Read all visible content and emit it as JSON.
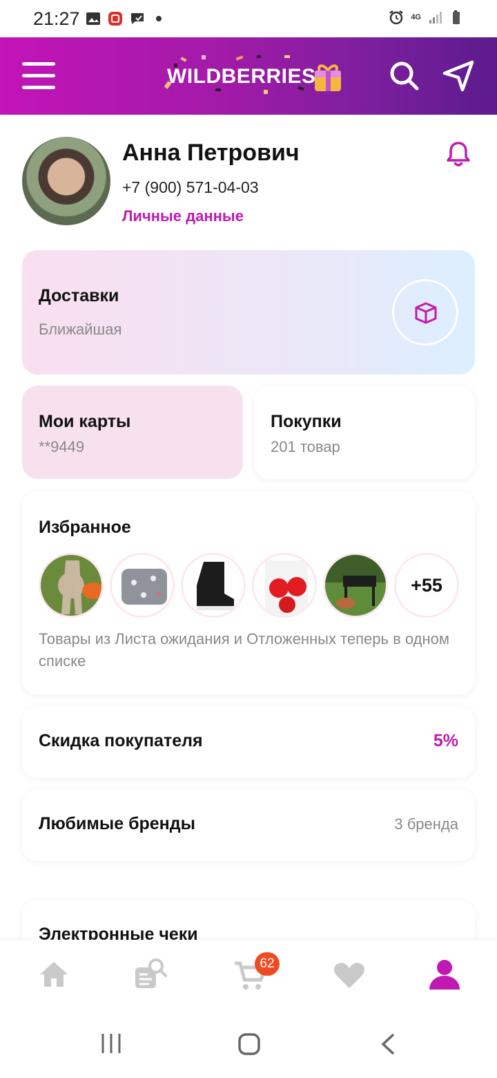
{
  "status_bar": {
    "time": "21:27",
    "network": "4G",
    "icons": [
      "image-icon",
      "app-icon",
      "message-icon",
      "alarm-icon",
      "signal-icon",
      "battery-icon"
    ]
  },
  "header": {
    "brand": "WILDBERRIES",
    "icons": [
      "menu-icon",
      "search-icon",
      "send-icon"
    ],
    "gradient": [
      "#c214b8",
      "#5c1b8c"
    ]
  },
  "profile": {
    "name": "Анна Петрович",
    "phone": "+7 (900) 571-04-03",
    "personal_data_link": "Личные данные"
  },
  "deliveries": {
    "title": "Доставки",
    "subtitle": "Ближайшая"
  },
  "my_cards": {
    "title": "Мои карты",
    "subtitle": "**9449"
  },
  "purchases": {
    "title": "Покупки",
    "subtitle": "201 товар"
  },
  "favorites": {
    "title": "Избранное",
    "items": [
      "pants",
      "pillowcase",
      "boot",
      "tomato-seeds",
      "grill"
    ],
    "more": "+55",
    "note": "Товары из Листа ожидания и Отложенных теперь в одном списке"
  },
  "discount": {
    "title": "Скидка покупателя",
    "value": "5%"
  },
  "brands": {
    "title": "Любимые бренды",
    "value": "3 бренда"
  },
  "receipts": {
    "title": "Электронные чеки"
  },
  "bottom_nav": {
    "items": [
      "home-icon",
      "catalog-icon",
      "cart-icon",
      "heart-icon",
      "profile-icon"
    ],
    "cart_badge": "62",
    "active": "profile-icon"
  },
  "colors": {
    "accent": "#c01ab3",
    "badge": "#ef4b23",
    "inactive": "#c9c9c9"
  }
}
